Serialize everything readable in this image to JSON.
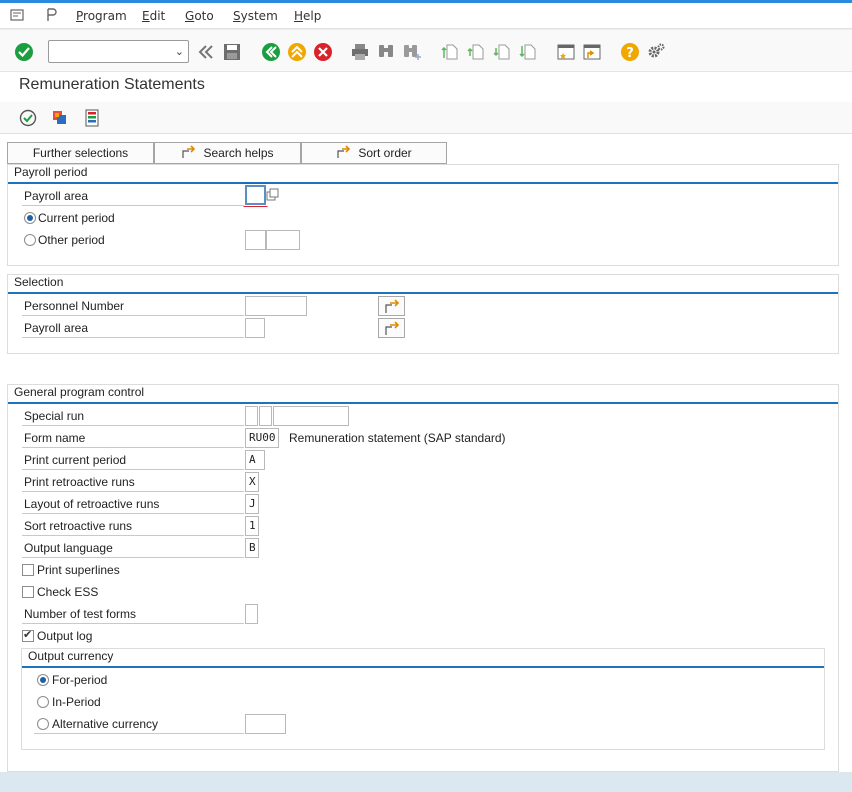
{
  "menu": {
    "items": [
      {
        "label": "Program",
        "key": "P"
      },
      {
        "label": "Edit",
        "key": "E"
      },
      {
        "label": "Goto",
        "key": "G"
      },
      {
        "label": "System",
        "key": "S"
      },
      {
        "label": "Help",
        "key": "H"
      }
    ]
  },
  "toolbar": {
    "command_value": "",
    "icons": [
      "enter-icon",
      "back-double-icon",
      "save-icon",
      "back-icon",
      "exit-icon",
      "cancel-icon",
      "print-icon",
      "find-icon",
      "find-next-icon",
      "first-page-icon",
      "prev-page-icon",
      "next-page-icon",
      "last-page-icon",
      "create-session-icon",
      "shortcut-icon",
      "help-icon",
      "settings-icon"
    ],
    "colors": {
      "green": "#1a9e3f",
      "amber": "#f0a800",
      "red": "#d9222a",
      "grey": "#8a8a8a"
    }
  },
  "title": "Remuneration Statements",
  "app_toolbar": {
    "icons": [
      "execute-icon",
      "get-variant-icon",
      "selection-options-icon"
    ]
  },
  "tabs": [
    {
      "label": "Further selections"
    },
    {
      "label": "Search helps"
    },
    {
      "label": "Sort order"
    }
  ],
  "payroll_period": {
    "title": "Payroll period",
    "payroll_area_label": "Payroll area",
    "payroll_area_value": "",
    "current_period_label": "Current period",
    "other_period_label": "Other period",
    "selected": "current"
  },
  "selection": {
    "title": "Selection",
    "personnel_number_label": "Personnel Number",
    "personnel_number_value": "",
    "payroll_area_label": "Payroll area",
    "payroll_area_value": ""
  },
  "general": {
    "title": "General program control",
    "special_run_label": "Special run",
    "form_name_label": "Form name",
    "form_name_value": "RU00",
    "form_name_desc": "Remuneration statement (SAP standard)",
    "print_current_label": "Print current period",
    "print_current_value": "A",
    "print_retro_label": "Print retroactive runs",
    "print_retro_value": "X",
    "layout_retro_label": "Layout of retroactive runs",
    "layout_retro_value": "J",
    "sort_retro_label": "Sort retroactive runs",
    "sort_retro_value": "1",
    "output_lang_label": "Output language",
    "output_lang_value": "B",
    "print_superlines_label": "Print superlines",
    "print_superlines_checked": false,
    "check_ess_label": "Check ESS",
    "check_ess_checked": false,
    "num_test_forms_label": "Number of test forms",
    "num_test_forms_value": "",
    "output_log_label": "Output log",
    "output_log_checked": true
  },
  "output_currency": {
    "title": "Output currency",
    "for_period_label": "For-period",
    "in_period_label": "In-Period",
    "alt_currency_label": "Alternative currency",
    "alt_currency_value": "",
    "selected": "for-period"
  }
}
